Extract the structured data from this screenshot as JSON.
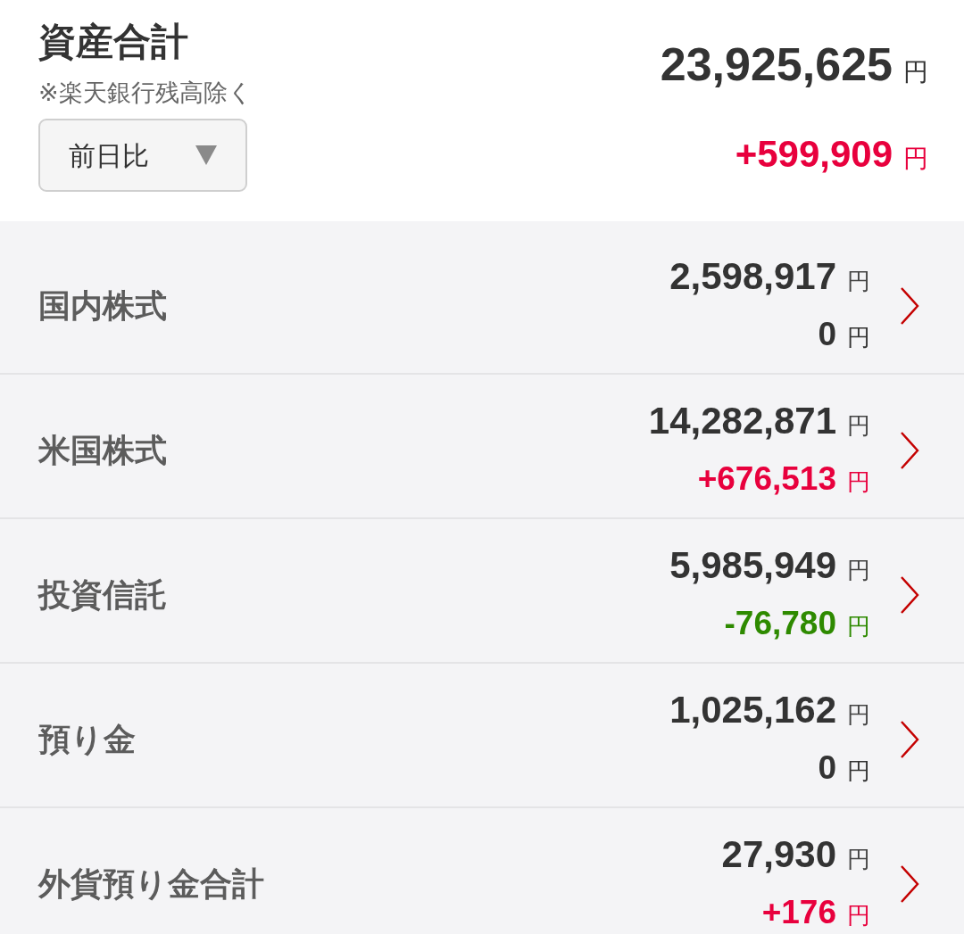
{
  "header": {
    "title": "資産合計",
    "note": "※楽天銀行残高除く",
    "period_selector": {
      "label": "前日比"
    },
    "total": {
      "amount": "23,925,625",
      "unit": "円"
    },
    "change": {
      "amount": "+599,909",
      "unit": "円",
      "color": "#e8003d"
    }
  },
  "assets": [
    {
      "name": "国内株式",
      "value": {
        "amount": "2,598,917",
        "unit": "円"
      },
      "change": {
        "amount": "0",
        "unit": "円",
        "color": "#333333"
      }
    },
    {
      "name": "米国株式",
      "value": {
        "amount": "14,282,871",
        "unit": "円"
      },
      "change": {
        "amount": "+676,513",
        "unit": "円",
        "color": "#e8003d"
      }
    },
    {
      "name": "投資信託",
      "value": {
        "amount": "5,985,949",
        "unit": "円"
      },
      "change": {
        "amount": "-76,780",
        "unit": "円",
        "color": "#2e8a00"
      }
    },
    {
      "name": "預り金",
      "value": {
        "amount": "1,025,162",
        "unit": "円"
      },
      "change": {
        "amount": "0",
        "unit": "円",
        "color": "#333333"
      }
    },
    {
      "name": "外貨預り金合計",
      "value": {
        "amount": "27,930",
        "unit": "円"
      },
      "change": {
        "amount": "+176",
        "unit": "円",
        "color": "#e8003d"
      }
    }
  ]
}
